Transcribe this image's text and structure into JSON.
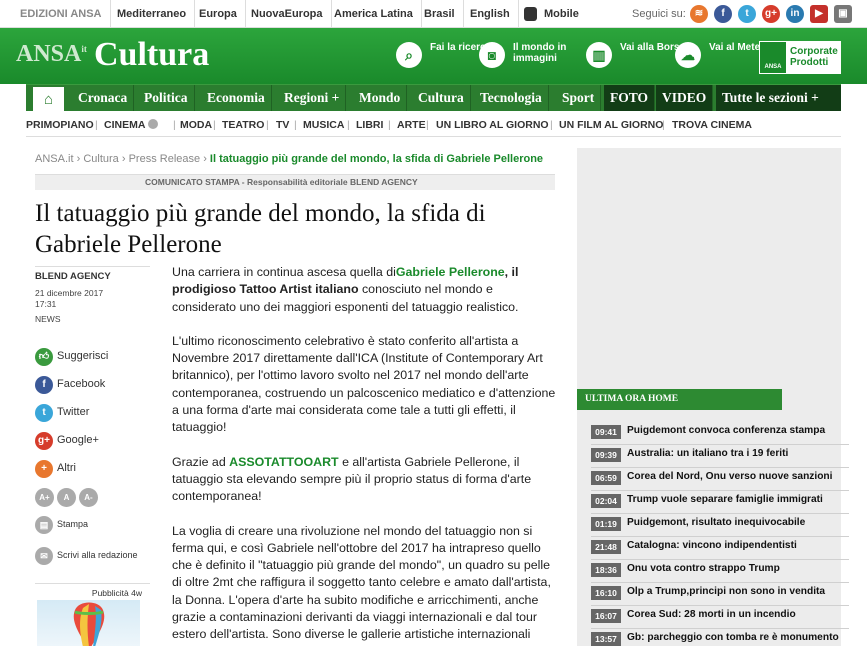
{
  "topbar": {
    "items": [
      "EDIZIONI ANSA",
      "Mediterraneo",
      "Europa",
      "NuovaEuropa",
      "America Latina",
      "Brasil",
      "English",
      "Mobile"
    ],
    "seguici": "Seguici su:"
  },
  "header": {
    "logo_ansa": "ANSA",
    "logo_ansa_sup": "it",
    "section": "Cultura",
    "links": [
      {
        "label": "Fai la ricerca",
        "icon": "search-icon"
      },
      {
        "label": "Il mondo in immagini",
        "icon": "camera-icon"
      },
      {
        "label": "Vai alla Borsa",
        "icon": "chart-icon"
      },
      {
        "label": "Vai al Meteo",
        "icon": "weather-icon"
      }
    ],
    "corporate": "Corporate Prodotti",
    "corporate_logo": "ANSA"
  },
  "nav": {
    "items": [
      "Cronaca",
      "Politica",
      "Economia",
      "Regioni +",
      "Mondo",
      "Cultura",
      "Tecnologia",
      "Sport",
      "FOTO",
      "VIDEO",
      "Tutte le sezioni +"
    ]
  },
  "subnav": {
    "items": [
      "PRIMOPIANO",
      "CINEMA",
      "MODA",
      "TEATRO",
      "TV",
      "MUSICA",
      "LIBRI",
      "ARTE",
      "UN LIBRO AL GIORNO",
      "UN FILM AL GIORNO",
      "TROVA CINEMA"
    ]
  },
  "breadcrumb": {
    "items": [
      "ANSA.it",
      "Cultura",
      "Press Release"
    ],
    "current": "Il tatuaggio più grande del mondo, la sfida di Gabriele Pellerone"
  },
  "press_note": "COMUNICATO STAMPA - Responsabilità editoriale BLEND AGENCY",
  "article": {
    "title": "Il tatuaggio più grande del mondo, la sfida di Gabriele Pellerone",
    "agency": "BLEND AGENCY",
    "date": "21 dicembre 2017",
    "time": "17:31",
    "category": "NEWS",
    "p1_a": "Una carriera in continua ascesa quella di",
    "p1_link": "Gabriele Pellerone",
    "p1_b": ", il prodigioso Tattoo Artist italiano",
    "p1_c": " conosciuto nel mondo e considerato uno dei maggiori esponenti del tatuaggio realistico.",
    "p2": "L'ultimo riconoscimento celebrativo è stato conferito all'artista a Novembre 2017 direttamente dall'ICA (Institute of Contemporary Art britannico), per l'ottimo lavoro svolto nel 2017 nel mondo dell'arte contemporanea, costruendo un palcoscenico mediatico e d'attenzione a una forma d'arte mai considerata come tale a tutti gli effetti, il tatuaggio!",
    "p3_a": "Grazie ad ",
    "p3_link": "ASSOTATTOOART",
    "p3_b": " e all'artista Gabriele Pellerone, il tatuaggio sta elevando sempre più il proprio status di forma d'arte contemporanea!",
    "p4": "La voglia di creare una rivoluzione nel mondo del tatuaggio non si ferma qui, e così Gabriele nell'ottobre del 2017 ha intrapreso quello che è definito il \"tatuaggio più grande del mondo\", un quadro su pelle di oltre 2mt che raffigura il soggetto tanto celebre e amato dall'artista, la Donna.  L'opera d'arte ha subito modifiche e arricchimenti, anche grazie a contaminazioni derivanti da viaggi internazionali e dal tour estero dell'artista. Sono diverse le gallerie artistiche internazionali (dagli USA alla Cina) che si stanno"
  },
  "share": {
    "items": [
      {
        "label": "Suggerisci",
        "color": "#3a9a3e",
        "icon": "thumb-icon"
      },
      {
        "label": "Facebook",
        "color": "#3b5998",
        "icon": "facebook-icon"
      },
      {
        "label": "Twitter",
        "color": "#3aa6d9",
        "icon": "twitter-icon"
      },
      {
        "label": "Google+",
        "color": "#d63c2b",
        "icon": "googleplus-icon"
      },
      {
        "label": "Altri",
        "color": "#e8772e",
        "icon": "plus-icon"
      }
    ],
    "font_buttons": [
      "A+",
      "A",
      "A-"
    ],
    "print": "Stampa",
    "write": "Scrivi alla redazione"
  },
  "ad": {
    "label": "Pubblicità 4w"
  },
  "ultima_ora": {
    "title": "ULTIMA ORA HOME",
    "items": [
      {
        "time": "09:41",
        "text": "Puigdemont convoca conferenza stampa"
      },
      {
        "time": "09:39",
        "text": "Australia: un italiano tra i 19 feriti"
      },
      {
        "time": "06:59",
        "text": "Corea del Nord, Onu verso nuove sanzioni"
      },
      {
        "time": "02:04",
        "text": "Trump vuole separare famiglie immigrati"
      },
      {
        "time": "01:19",
        "text": "Puidgemont, risultato inequivocabile"
      },
      {
        "time": "21:48",
        "text": "Catalogna: vincono indipendentisti"
      },
      {
        "time": "18:36",
        "text": "Onu vota contro strappo Trump"
      },
      {
        "time": "16:10",
        "text": "Olp a Trump,principi non sono in vendita"
      },
      {
        "time": "16:07",
        "text": "Corea Sud: 28 morti in un incendio"
      },
      {
        "time": "13:57",
        "text": "Gb: parcheggio con tomba re è monumento"
      }
    ]
  },
  "colors": {
    "brand_green": "#1a8a2b",
    "nav_green": "#2b7d2f",
    "nav_dark": "#123d16"
  }
}
